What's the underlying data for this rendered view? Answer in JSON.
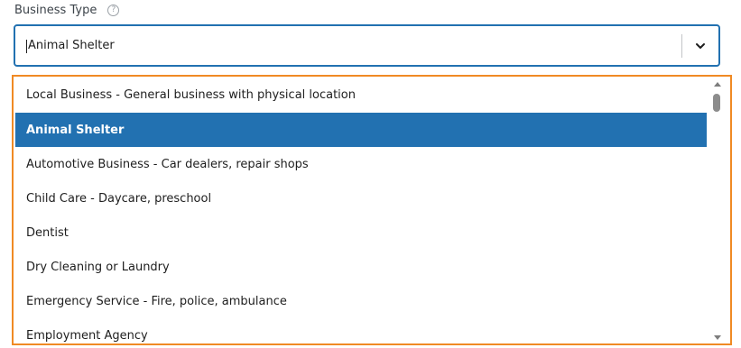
{
  "field": {
    "label": "Business Type",
    "help_icon_glyph": "?",
    "help_icon": "question-circle-icon"
  },
  "select": {
    "value": "Animal Shelter",
    "dropdown_icon": "chevron-down-icon"
  },
  "options": [
    {
      "label": "Local Business - General business with physical location",
      "selected": false
    },
    {
      "label": "Animal Shelter",
      "selected": true
    },
    {
      "label": "Automotive Business - Car dealers, repair shops",
      "selected": false
    },
    {
      "label": "Child Care - Daycare, preschool",
      "selected": false
    },
    {
      "label": "Dentist",
      "selected": false
    },
    {
      "label": "Dry Cleaning or Laundry",
      "selected": false
    },
    {
      "label": "Emergency Service - Fire, police, ambulance",
      "selected": false
    },
    {
      "label": "Employment Agency",
      "selected": false
    }
  ],
  "colors": {
    "focus_border": "#2271b1",
    "selected_bg": "#2271b1",
    "menu_outline": "#f08a24"
  }
}
